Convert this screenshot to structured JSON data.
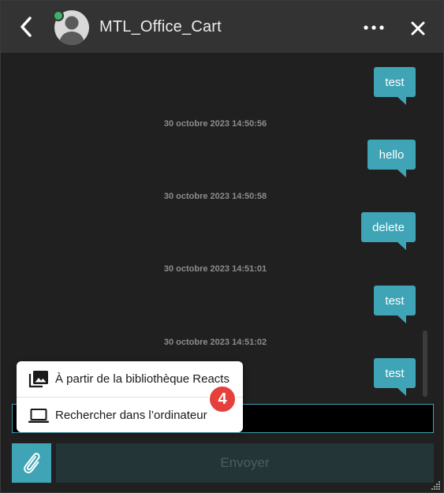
{
  "header": {
    "contact_name": "MTL_Office_Cart",
    "status": "online"
  },
  "messages": [
    {
      "text": "test"
    },
    {
      "timestamp": "30 octobre 2023 14:50:56"
    },
    {
      "text": "hello"
    },
    {
      "timestamp": "30 octobre 2023 14:50:58"
    },
    {
      "text": "delete"
    },
    {
      "timestamp": "30 octobre 2023 14:51:01"
    },
    {
      "text": "test"
    },
    {
      "timestamp": "30 octobre 2023 14:51:02"
    },
    {
      "text": "test"
    }
  ],
  "attach_menu": {
    "items": [
      {
        "label": "À partir de la bibliothèque Reacts",
        "icon": "photo-library-icon"
      },
      {
        "label": "Rechercher dans l’ordinateur",
        "icon": "laptop-icon"
      }
    ]
  },
  "badge": {
    "value": "4"
  },
  "composer": {
    "input_value": "",
    "send_label": "Envoyer"
  },
  "colors": {
    "accent": "#3fa4b6",
    "header_bg": "#333333",
    "chat_bg": "#202020",
    "badge": "#e5403c",
    "status_online": "#3db36a"
  }
}
